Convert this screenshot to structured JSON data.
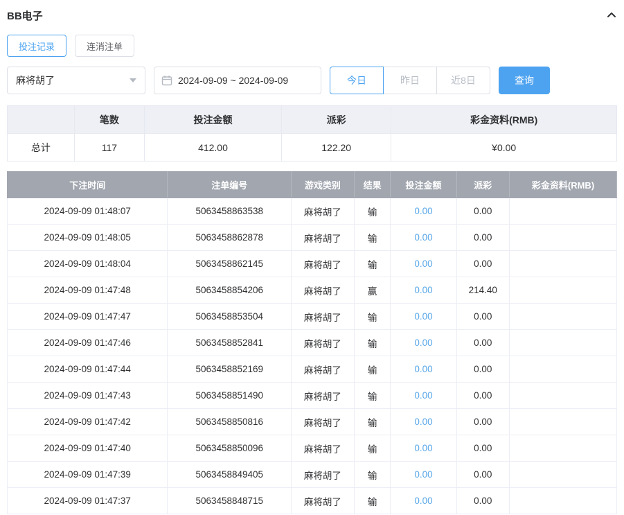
{
  "panel": {
    "title": "BB电子"
  },
  "tabs": [
    {
      "label": "投注记录",
      "active": true
    },
    {
      "label": "连消注单",
      "active": false
    }
  ],
  "filters": {
    "game_select_value": "麻将胡了",
    "date_range_value": "2024-09-09 ~ 2024-09-09",
    "quick_buttons": [
      {
        "label": "今日",
        "active": true
      },
      {
        "label": "昨日",
        "active": false
      },
      {
        "label": "近8日",
        "active": false
      }
    ],
    "search_label": "查询"
  },
  "summary": {
    "headers": [
      "",
      "笔数",
      "投注金额",
      "派彩",
      "彩金资料(RMB)"
    ],
    "row_label": "总计",
    "count": "117",
    "bet_amount": "412.00",
    "payout": "122.20",
    "bonus": "¥0.00"
  },
  "table": {
    "headers": [
      "下注时间",
      "注单编号",
      "游戏类别",
      "结果",
      "投注金额",
      "派彩",
      "彩金资料(RMB)"
    ],
    "col_keys": [
      "bet-time",
      "order-no",
      "game-type",
      "result",
      "bet-amount",
      "payout",
      "bonus"
    ],
    "rows": [
      [
        "2024-09-09 01:48:07",
        "5063458863538",
        "麻将胡了",
        "输",
        "0.00",
        "0.00",
        ""
      ],
      [
        "2024-09-09 01:48:05",
        "5063458862878",
        "麻将胡了",
        "输",
        "0.00",
        "0.00",
        ""
      ],
      [
        "2024-09-09 01:48:04",
        "5063458862145",
        "麻将胡了",
        "输",
        "0.00",
        "0.00",
        ""
      ],
      [
        "2024-09-09 01:47:48",
        "5063458854206",
        "麻将胡了",
        "赢",
        "0.00",
        "214.40",
        ""
      ],
      [
        "2024-09-09 01:47:47",
        "5063458853504",
        "麻将胡了",
        "输",
        "0.00",
        "0.00",
        ""
      ],
      [
        "2024-09-09 01:47:46",
        "5063458852841",
        "麻将胡了",
        "输",
        "0.00",
        "0.00",
        ""
      ],
      [
        "2024-09-09 01:47:44",
        "5063458852169",
        "麻将胡了",
        "输",
        "0.00",
        "0.00",
        ""
      ],
      [
        "2024-09-09 01:47:43",
        "5063458851490",
        "麻将胡了",
        "输",
        "0.00",
        "0.00",
        ""
      ],
      [
        "2024-09-09 01:47:42",
        "5063458850816",
        "麻将胡了",
        "输",
        "0.00",
        "0.00",
        ""
      ],
      [
        "2024-09-09 01:47:40",
        "5063458850096",
        "麻将胡了",
        "输",
        "0.00",
        "0.00",
        ""
      ],
      [
        "2024-09-09 01:47:39",
        "5063458849405",
        "麻将胡了",
        "输",
        "0.00",
        "0.00",
        ""
      ],
      [
        "2024-09-09 01:47:37",
        "5063458848715",
        "麻将胡了",
        "输",
        "0.00",
        "0.00",
        ""
      ]
    ]
  },
  "colors": {
    "accent_blue": "#4da3f0",
    "link_blue": "#58a7e8",
    "table_header_bg": "#a1a6af",
    "summary_header_bg": "#eef0f5",
    "border": "#ebeef5"
  }
}
